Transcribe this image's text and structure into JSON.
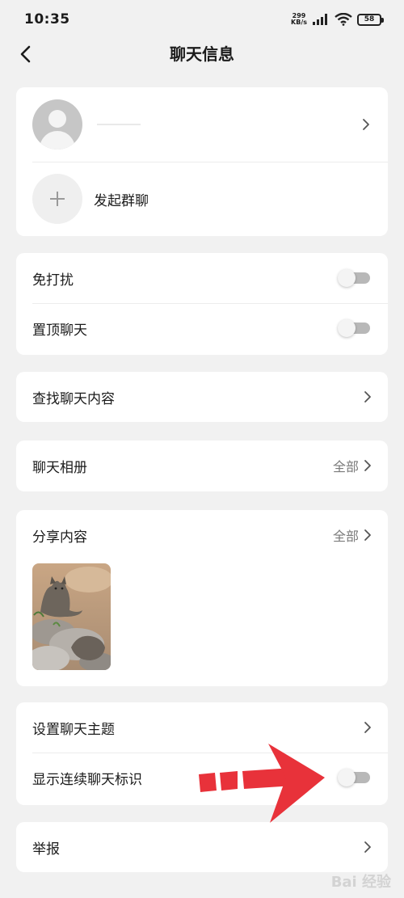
{
  "status_bar": {
    "time": "10:35",
    "net_speed_value": "299",
    "net_speed_unit": "KB/s",
    "battery": "58"
  },
  "header": {
    "title": "聊天信息"
  },
  "members": {
    "add_group_label": "发起群聊"
  },
  "settings_group_1": {
    "do_not_disturb": {
      "label": "免打扰",
      "enabled": false
    },
    "pin_chat": {
      "label": "置顶聊天",
      "enabled": false
    }
  },
  "search": {
    "label": "查找聊天内容"
  },
  "album": {
    "label": "聊天相册",
    "right_text": "全部"
  },
  "share": {
    "label": "分享内容",
    "right_text": "全部"
  },
  "settings_group_2": {
    "theme_label": "设置聊天主题",
    "streak": {
      "label": "显示连续聊天标识",
      "enabled": false
    }
  },
  "report": {
    "label": "举报"
  },
  "watermark": "Bai 经验",
  "colors": {
    "background": "#f1f1f1",
    "card": "#ffffff",
    "toggle_off": "#b8b8b8",
    "annotation_arrow": "#e8323a"
  },
  "icons": [
    "back-arrow-icon",
    "chevron-right-icon",
    "avatar-placeholder-icon",
    "plus-icon",
    "wifi-icon",
    "signal-icon",
    "battery-icon"
  ]
}
